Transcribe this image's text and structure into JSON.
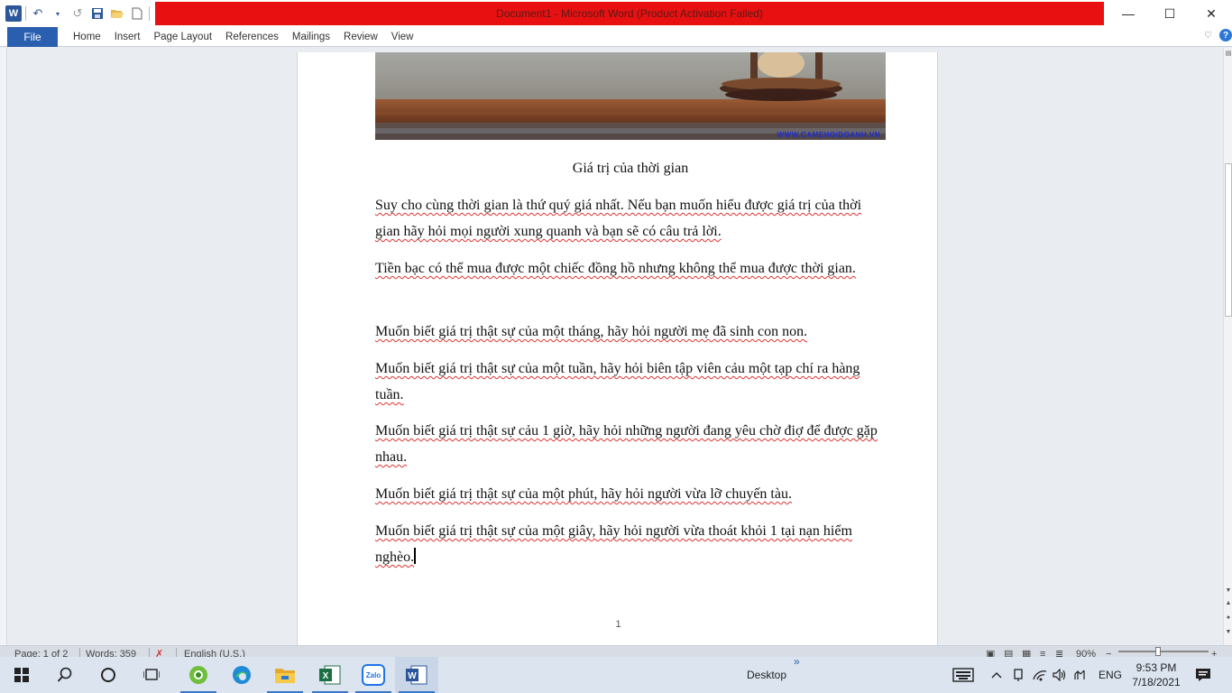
{
  "window": {
    "title": "Document1  -  Microsoft Word (Product Activation Failed)",
    "minimize_glyph": "—",
    "maximize_glyph": "☐",
    "close_glyph": "✕"
  },
  "quick_access": {
    "word_icon": "W",
    "undo_glyph": "↶",
    "redo_glyph": "↺"
  },
  "ribbon": {
    "file_label": "File",
    "tabs": [
      "Home",
      "Insert",
      "Page Layout",
      "References",
      "Mailings",
      "Review",
      "View"
    ],
    "help_glyph": "?"
  },
  "document": {
    "photo_caption": "WWW.CAMEHOIDOANH.VN",
    "title": "Giá trị của thời gian",
    "paragraphs": [
      "Suy cho cùng thời gian là thứ quý giá nhất. Nếu bạn muốn hiểu được giá trị của thời gian  hãy hỏi mọi người xung quanh và bạn sẽ có câu trả lời.",
      "Tiền bạc có thể mua được một chiếc đồng hồ nhưng không thể mua được thời gian.",
      "Muốn biết giá trị thật sự của  một tháng, hãy hỏi người mẹ đã sinh con non.",
      "Muốn biết giá trị thật sự của một tuần, hãy hỏi biên tập viên cảu một tạp chí ra hàng tuần.",
      "Muốn biết giá trị thật sự cảu 1 giờ, hãy hỏi những người đang yêu chờ điợ để được gặp nhau.",
      "Muốn biết giá trị thật sự của một phút, hãy hỏi người vừa lỡ chuyến tàu.",
      "Muốn biết giá trị thật sự của một giây, hãy hỏi người vừa thoát khỏi 1 tại nạn hiểm nghèo."
    ],
    "page_number": "1"
  },
  "statusbar": {
    "page": "Page: 1 of 2",
    "words": "Words: 359",
    "language": "English (U.S.)",
    "zoom": "90%",
    "zoom_out_glyph": "−",
    "zoom_in_glyph": "+"
  },
  "taskbar": {
    "desktop_label": "Desktop",
    "chevron": "»",
    "language": "ENG",
    "time": "9:53 PM",
    "date": "7/18/2021",
    "zalo_label": "Zalo"
  },
  "colors": {
    "title_bar_red": "#e81010",
    "file_tab": "#2a5fb0",
    "spellcheck": "#d33"
  },
  "icons": [
    "word-icon",
    "undo-icon",
    "redo-icon",
    "save-icon",
    "open-icon",
    "new-icon",
    "customize-icon",
    "minimize-icon",
    "maximize-icon",
    "close-icon",
    "help-icon",
    "windows-start-icon",
    "search-icon",
    "cortana-icon",
    "task-view-icon",
    "coccoc-icon",
    "edge-icon",
    "file-explorer-icon",
    "excel-icon",
    "zalo-icon",
    "word-taskbar-icon",
    "keyboard-icon",
    "tray-up-icon",
    "network-icon",
    "wifi-icon",
    "volume-icon",
    "notification-icon"
  ]
}
